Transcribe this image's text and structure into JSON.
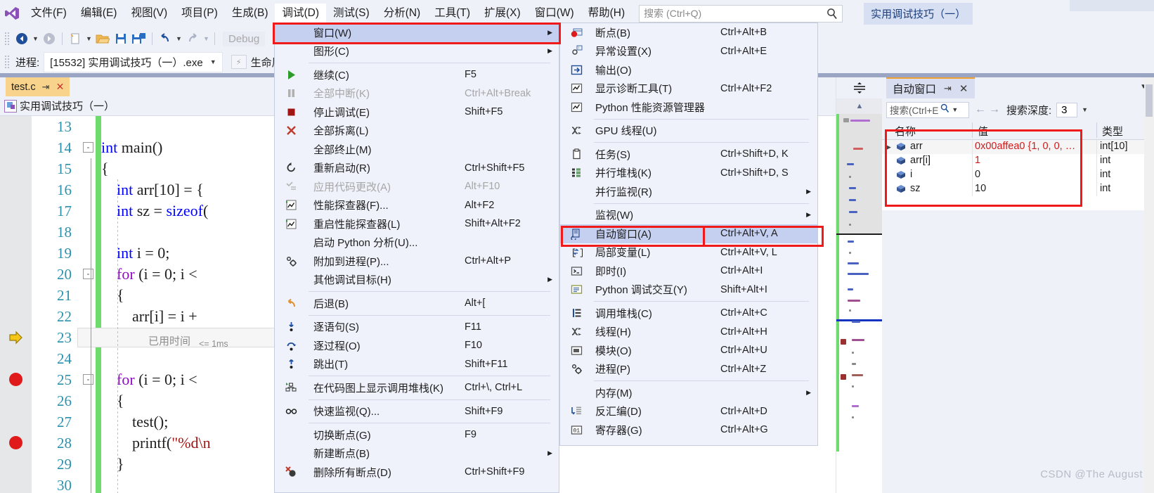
{
  "app": {
    "title_chip": "实用调试技巧（一）",
    "watermark": "CSDN @The  August"
  },
  "menubar": {
    "items": [
      {
        "label": "文件(F)",
        "active": false
      },
      {
        "label": "编辑(E)",
        "active": false
      },
      {
        "label": "视图(V)",
        "active": false
      },
      {
        "label": "项目(P)",
        "active": false
      },
      {
        "label": "生成(B)",
        "active": false
      },
      {
        "label": "调试(D)",
        "active": true
      },
      {
        "label": "测试(S)",
        "active": false
      },
      {
        "label": "分析(N)",
        "active": false
      },
      {
        "label": "工具(T)",
        "active": false
      },
      {
        "label": "扩展(X)",
        "active": false
      },
      {
        "label": "窗口(W)",
        "active": false
      },
      {
        "label": "帮助(H)",
        "active": false
      }
    ],
    "search_placeholder": "搜索 (Ctrl+Q)"
  },
  "toolbar": {
    "config": "Debug",
    "process_label": "进程:",
    "process_value": "[15532] 实用调试技巧（一）.exe",
    "lifecycle_label": "生命周期"
  },
  "editor": {
    "tab_name": "test.c",
    "nav_scope": "实用调试技巧（一）",
    "line_start": 13,
    "lines": [
      {
        "n": 13,
        "text": "",
        "fold": "",
        "bp": false,
        "arrow": false
      },
      {
        "n": 14,
        "text": "int main()",
        "fold": "-",
        "bp": false,
        "arrow": false
      },
      {
        "n": 15,
        "text": "{",
        "fold": "",
        "bp": false,
        "arrow": false
      },
      {
        "n": 16,
        "text": "    int arr[10] = {",
        "fold": "",
        "bp": false,
        "arrow": false
      },
      {
        "n": 17,
        "text": "    int sz = sizeof(",
        "fold": "",
        "bp": false,
        "arrow": false
      },
      {
        "n": 18,
        "text": "",
        "fold": "",
        "bp": false,
        "arrow": false
      },
      {
        "n": 19,
        "text": "    int i = 0;",
        "fold": "",
        "bp": false,
        "arrow": false
      },
      {
        "n": 20,
        "text": "    for (i = 0; i <",
        "fold": "-",
        "bp": false,
        "arrow": false
      },
      {
        "n": 21,
        "text": "    {",
        "fold": "",
        "bp": false,
        "arrow": false
      },
      {
        "n": 22,
        "text": "        arr[i] = i +",
        "fold": "",
        "bp": false,
        "arrow": false
      },
      {
        "n": 23,
        "text": "    }",
        "fold": "",
        "bp": false,
        "arrow": true
      },
      {
        "n": 24,
        "text": "",
        "fold": "",
        "bp": false,
        "arrow": false
      },
      {
        "n": 25,
        "text": "    for (i = 0; i <",
        "fold": "-",
        "bp": true,
        "arrow": false
      },
      {
        "n": 26,
        "text": "    {",
        "fold": "",
        "bp": false,
        "arrow": false
      },
      {
        "n": 27,
        "text": "        test();",
        "fold": "",
        "bp": false,
        "arrow": false
      },
      {
        "n": 28,
        "text": "        printf(\"%d\\n",
        "fold": "",
        "bp": true,
        "arrow": false
      },
      {
        "n": 29,
        "text": "    }",
        "fold": "",
        "bp": false,
        "arrow": false
      },
      {
        "n": 30,
        "text": "",
        "fold": "",
        "bp": false,
        "arrow": false
      }
    ],
    "elapsed_label": "已用时间",
    "elapsed_value": "<= 1ms"
  },
  "debug_menu": {
    "items": [
      {
        "label": "窗口(W)",
        "key": "",
        "icon": "",
        "arrow": true,
        "sel": true,
        "disabled": false
      },
      {
        "label": "图形(C)",
        "key": "",
        "icon": "",
        "arrow": true,
        "sel": false,
        "disabled": false
      },
      {
        "sep": true
      },
      {
        "label": "继续(C)",
        "key": "F5",
        "icon": "play-green",
        "arrow": false,
        "sel": false,
        "disabled": false
      },
      {
        "label": "全部中断(K)",
        "key": "Ctrl+Alt+Break",
        "icon": "pause-gray",
        "arrow": false,
        "sel": false,
        "disabled": true
      },
      {
        "label": "停止调试(E)",
        "key": "Shift+F5",
        "icon": "stop-red",
        "arrow": false,
        "sel": false,
        "disabled": false
      },
      {
        "label": "全部拆离(L)",
        "key": "",
        "icon": "x-red",
        "arrow": false,
        "sel": false,
        "disabled": false
      },
      {
        "label": "全部终止(M)",
        "key": "",
        "icon": "",
        "arrow": false,
        "sel": false,
        "disabled": false
      },
      {
        "label": "重新启动(R)",
        "key": "Ctrl+Shift+F5",
        "icon": "restart",
        "arrow": false,
        "sel": false,
        "disabled": false
      },
      {
        "label": "应用代码更改(A)",
        "key": "Alt+F10",
        "icon": "apply-gray",
        "arrow": false,
        "sel": false,
        "disabled": true
      },
      {
        "label": "性能探查器(F)...",
        "key": "Alt+F2",
        "icon": "perf",
        "arrow": false,
        "sel": false,
        "disabled": false
      },
      {
        "label": "重启性能探查器(L)",
        "key": "Shift+Alt+F2",
        "icon": "perf",
        "arrow": false,
        "sel": false,
        "disabled": false
      },
      {
        "label": "启动 Python 分析(U)...",
        "key": "",
        "icon": "",
        "arrow": false,
        "sel": false,
        "disabled": false
      },
      {
        "label": "附加到进程(P)...",
        "key": "Ctrl+Alt+P",
        "icon": "gears",
        "arrow": false,
        "sel": false,
        "disabled": false
      },
      {
        "label": "其他调试目标(H)",
        "key": "",
        "icon": "",
        "arrow": true,
        "sel": false,
        "disabled": false
      },
      {
        "sep": true
      },
      {
        "label": "后退(B)",
        "key": "Alt+[",
        "icon": "undo-orange",
        "arrow": false,
        "sel": false,
        "disabled": false
      },
      {
        "sep": true
      },
      {
        "label": "逐语句(S)",
        "key": "F11",
        "icon": "step-into",
        "arrow": false,
        "sel": false,
        "disabled": false
      },
      {
        "label": "逐过程(O)",
        "key": "F10",
        "icon": "step-over",
        "arrow": false,
        "sel": false,
        "disabled": false
      },
      {
        "label": "跳出(T)",
        "key": "Shift+F11",
        "icon": "step-out",
        "arrow": false,
        "sel": false,
        "disabled": false
      },
      {
        "sep": true
      },
      {
        "label": "在代码图上显示调用堆栈(K)",
        "key": "Ctrl+\\, Ctrl+L",
        "icon": "codemap",
        "arrow": false,
        "sel": false,
        "disabled": false
      },
      {
        "sep": true
      },
      {
        "label": "快速监视(Q)...",
        "key": "Shift+F9",
        "icon": "glasses",
        "arrow": false,
        "sel": false,
        "disabled": false
      },
      {
        "sep": true
      },
      {
        "label": "切换断点(G)",
        "key": "F9",
        "icon": "",
        "arrow": false,
        "sel": false,
        "disabled": false
      },
      {
        "label": "新建断点(B)",
        "key": "",
        "icon": "",
        "arrow": true,
        "sel": false,
        "disabled": false
      },
      {
        "label": "删除所有断点(D)",
        "key": "Ctrl+Shift+F9",
        "icon": "bp-delete",
        "arrow": false,
        "sel": false,
        "disabled": false
      }
    ]
  },
  "window_submenu": {
    "items": [
      {
        "label": "断点(B)",
        "key": "Ctrl+Alt+B",
        "icon": "breakpoint",
        "sel": false
      },
      {
        "label": "异常设置(X)",
        "key": "Ctrl+Alt+E",
        "icon": "exception",
        "sel": false
      },
      {
        "label": "输出(O)",
        "key": "",
        "icon": "output",
        "sel": false
      },
      {
        "label": "显示诊断工具(T)",
        "key": "Ctrl+Alt+F2",
        "icon": "chart",
        "sel": false
      },
      {
        "label": "Python 性能资源管理器",
        "key": "",
        "icon": "chart",
        "sel": false
      },
      {
        "sep": true
      },
      {
        "label": "GPU 线程(U)",
        "key": "",
        "icon": "threads",
        "sel": false
      },
      {
        "sep": true
      },
      {
        "label": "任务(S)",
        "key": "Ctrl+Shift+D, K",
        "icon": "tasks",
        "sel": false
      },
      {
        "label": "并行堆栈(K)",
        "key": "Ctrl+Shift+D, S",
        "icon": "parallel",
        "sel": false
      },
      {
        "label": "并行监视(R)",
        "key": "",
        "icon": "",
        "arrow": true,
        "sel": false
      },
      {
        "sep": true
      },
      {
        "label": "监视(W)",
        "key": "",
        "icon": "",
        "arrow": true,
        "sel": false
      },
      {
        "label": "自动窗口(A)",
        "key": "Ctrl+Alt+V, A",
        "icon": "autos",
        "sel": true
      },
      {
        "label": "局部变量(L)",
        "key": "Ctrl+Alt+V, L",
        "icon": "locals",
        "sel": false
      },
      {
        "label": "即时(I)",
        "key": "Ctrl+Alt+I",
        "icon": "immediate",
        "sel": false
      },
      {
        "label": "Python 调试交互(Y)",
        "key": "Shift+Alt+I",
        "icon": "pydebug",
        "sel": false
      },
      {
        "sep": true
      },
      {
        "label": "调用堆栈(C)",
        "key": "Ctrl+Alt+C",
        "icon": "callstack",
        "sel": false
      },
      {
        "label": "线程(H)",
        "key": "Ctrl+Alt+H",
        "icon": "threads",
        "sel": false
      },
      {
        "label": "模块(O)",
        "key": "Ctrl+Alt+U",
        "icon": "modules",
        "sel": false
      },
      {
        "label": "进程(P)",
        "key": "Ctrl+Alt+Z",
        "icon": "gears",
        "sel": false
      },
      {
        "sep": true
      },
      {
        "label": "内存(M)",
        "key": "",
        "icon": "",
        "arrow": true,
        "sel": false
      },
      {
        "label": "反汇编(D)",
        "key": "Ctrl+Alt+D",
        "icon": "disasm",
        "sel": false
      },
      {
        "label": "寄存器(G)",
        "key": "Ctrl+Alt+G",
        "icon": "registers",
        "sel": false
      }
    ]
  },
  "autos_panel": {
    "tab_title": "自动窗口",
    "search_placeholder": "搜索(Ctrl+E",
    "depth_label": "搜索深度:",
    "depth_value": "3",
    "columns": [
      "名称",
      "值",
      "类型"
    ],
    "rows": [
      {
        "name": "arr",
        "value": "0x00affea0 {1, 0, 0, …",
        "type": "int[10]",
        "expandable": true,
        "value_color": "#d11a1a"
      },
      {
        "name": "arr[i]",
        "value": "1",
        "type": "int",
        "expandable": false,
        "value_color": "#d11a1a"
      },
      {
        "name": "i",
        "value": "0",
        "type": "int",
        "expandable": false,
        "value_color": "#1e1e1e"
      },
      {
        "name": "sz",
        "value": "10",
        "type": "int",
        "expandable": false,
        "value_color": "#1e1e1e"
      }
    ]
  },
  "colors": {
    "highlight_red": "#f11a1a",
    "menu_bg": "#eff2fa",
    "selection": "#c5cff0",
    "tab_orange": "#f8d38c",
    "keyword_blue": "#0000ff",
    "keyword_purple": "#8f08c4",
    "string_red": "#a31515",
    "linenum_blue": "#2b91af"
  }
}
